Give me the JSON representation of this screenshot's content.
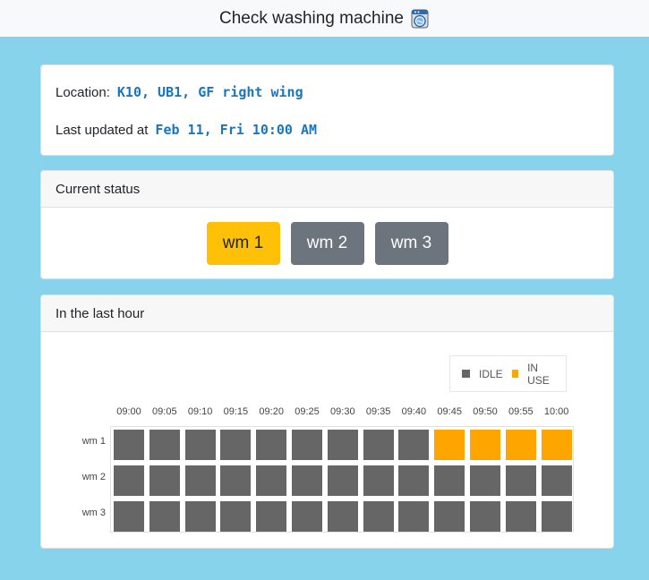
{
  "header": {
    "title": "Check washing machine",
    "icon": "washing-machine-icon"
  },
  "info": {
    "location_label": "Location:",
    "location_value": "K10, UB1, GF right wing",
    "updated_label": "Last updated at",
    "updated_value": "Feb 11, Fri 10:00 AM"
  },
  "status": {
    "title": "Current status",
    "machines": [
      {
        "label": "wm 1",
        "state": "IN USE"
      },
      {
        "label": "wm 2",
        "state": "IDLE"
      },
      {
        "label": "wm 3",
        "state": "IDLE"
      }
    ]
  },
  "history": {
    "title": "In the last hour",
    "legend": [
      {
        "label": "IDLE",
        "color": "#666666"
      },
      {
        "label": "IN USE",
        "color": "#ffa500"
      }
    ],
    "times": [
      "09:00",
      "09:05",
      "09:10",
      "09:15",
      "09:20",
      "09:25",
      "09:30",
      "09:35",
      "09:40",
      "09:45",
      "09:50",
      "09:55",
      "10:00"
    ],
    "rows": [
      {
        "label": "wm 1",
        "states": [
          "IDLE",
          "IDLE",
          "IDLE",
          "IDLE",
          "IDLE",
          "IDLE",
          "IDLE",
          "IDLE",
          "IDLE",
          "IN USE",
          "IN USE",
          "IN USE",
          "IN USE"
        ]
      },
      {
        "label": "wm 2",
        "states": [
          "IDLE",
          "IDLE",
          "IDLE",
          "IDLE",
          "IDLE",
          "IDLE",
          "IDLE",
          "IDLE",
          "IDLE",
          "IDLE",
          "IDLE",
          "IDLE",
          "IDLE"
        ]
      },
      {
        "label": "wm 3",
        "states": [
          "IDLE",
          "IDLE",
          "IDLE",
          "IDLE",
          "IDLE",
          "IDLE",
          "IDLE",
          "IDLE",
          "IDLE",
          "IDLE",
          "IDLE",
          "IDLE",
          "IDLE"
        ]
      }
    ]
  },
  "colors": {
    "in_use": "#ffc107",
    "idle": "#6c757d",
    "background": "#87d3eb",
    "accent_text": "#1b75bb"
  }
}
